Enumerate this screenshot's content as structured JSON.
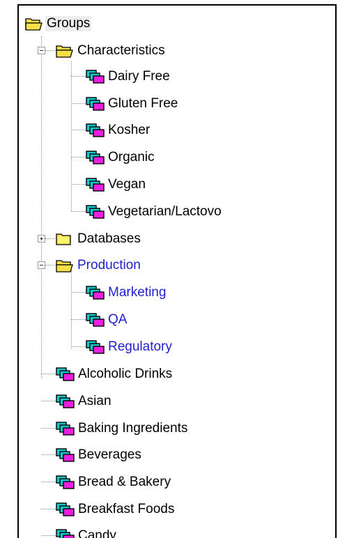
{
  "tree": {
    "root": {
      "label": "Groups",
      "icon": "folder-open-icon"
    },
    "characteristics": {
      "label": "Characteristics",
      "icon": "folder-open-icon",
      "items": [
        "Dairy Free",
        "Gluten Free",
        "Kosher",
        "Organic",
        "Vegan",
        "Vegetarian/Lactovo"
      ]
    },
    "databases": {
      "label": "Databases",
      "icon": "folder-closed-icon"
    },
    "production": {
      "label": "Production",
      "icon": "folder-open-icon",
      "items": [
        "Marketing",
        "QA",
        "Regulatory"
      ]
    },
    "groups": [
      "Alcoholic Drinks",
      "Asian",
      "Baking Ingredients",
      "Beverages",
      "Bread & Bakery",
      "Breakfast Foods",
      "Candy"
    ],
    "colors": {
      "folder": "#f5e04a",
      "group_cyan": "#12c8c8",
      "group_magenta": "#e81ee0",
      "highlight_text": "#1f1fd0"
    }
  }
}
